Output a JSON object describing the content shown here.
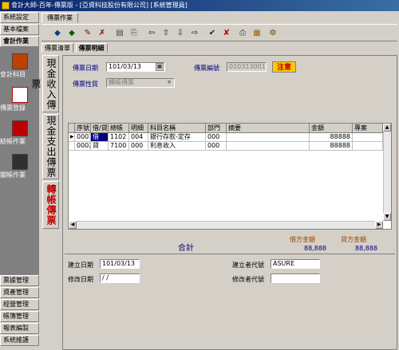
{
  "window": {
    "title": "會計大師-百年-傳票版 - [亞資科技股份有限公司] [系統管理員]"
  },
  "sidebar": {
    "top_buttons": [
      {
        "label": "系統設定"
      },
      {
        "label": "基本檔案"
      },
      {
        "label": "會計作業"
      }
    ],
    "items": [
      {
        "label": "會計科目",
        "icon": "ledger-icon",
        "color": "#c04000"
      },
      {
        "label": "傳票登錄",
        "icon": "voucher-icon",
        "color": "#c00000"
      },
      {
        "label": "結帳作業",
        "icon": "closing-icon",
        "color": "#c00000"
      },
      {
        "label": "關帳作業",
        "icon": "lock-icon",
        "color": "#303030"
      }
    ],
    "bottom_buttons": [
      {
        "label": "票據管理"
      },
      {
        "label": "資產管理"
      },
      {
        "label": "經營管理"
      },
      {
        "label": "帳簿管理"
      },
      {
        "label": "報表編製"
      },
      {
        "label": "系統維護"
      }
    ]
  },
  "main": {
    "tab": "傳票作業",
    "subtabs": [
      {
        "label": "傳票清單"
      },
      {
        "label": "傳票明細"
      }
    ],
    "vtabs": [
      {
        "label": "現金收入傳票"
      },
      {
        "label": "現金支出傳票"
      },
      {
        "label": "轉帳傳票"
      }
    ],
    "toolbar_icons": [
      "first-record-icon",
      "prev-record-icon",
      "add-icon",
      "edit-icon",
      "delete-icon",
      "copy-icon",
      "search-icon",
      "arrow-left-icon",
      "arrow-up-icon",
      "arrow-down-icon",
      "arrow-right-icon",
      "confirm-icon",
      "cancel-icon",
      "print-icon",
      "report-icon",
      "exit-icon"
    ]
  },
  "form": {
    "date_label": "傳票日期",
    "date_value": "101/03/13",
    "number_label": "傳票編號",
    "number_value": "010313001",
    "note_label": "注意",
    "type_label": "傳票性質",
    "type_value": "轉帳傳票"
  },
  "grid": {
    "columns": [
      "序號",
      "借/貸",
      "總帳",
      "明細",
      "科目名稱",
      "部門",
      "摘要",
      "金額",
      "專案"
    ],
    "rows": [
      {
        "seq": "0001",
        "dc": "借",
        "gl": "1102",
        "detail": "004",
        "name": "銀行存款-定存",
        "dept": "000",
        "memo": "",
        "amount": "88888",
        "proj": ""
      },
      {
        "seq": "0002",
        "dc": "貸",
        "gl": "7100",
        "detail": "000",
        "name": "利息收入",
        "dept": "000",
        "memo": "",
        "amount": "88888",
        "proj": ""
      }
    ]
  },
  "totals": {
    "label": "合計",
    "debit_label": "借方金額",
    "debit_value": "88,888",
    "credit_label": "貸方金額",
    "credit_value": "88,888"
  },
  "audit": {
    "created_date_label": "建立日期",
    "created_date_value": "101/03/13",
    "modified_date_label": "修改日期",
    "modified_date_value": " / /",
    "creator_label": "建立者代號",
    "creator_value": "ASURE",
    "modifier_label": "修改者代號",
    "modifier_value": ""
  }
}
